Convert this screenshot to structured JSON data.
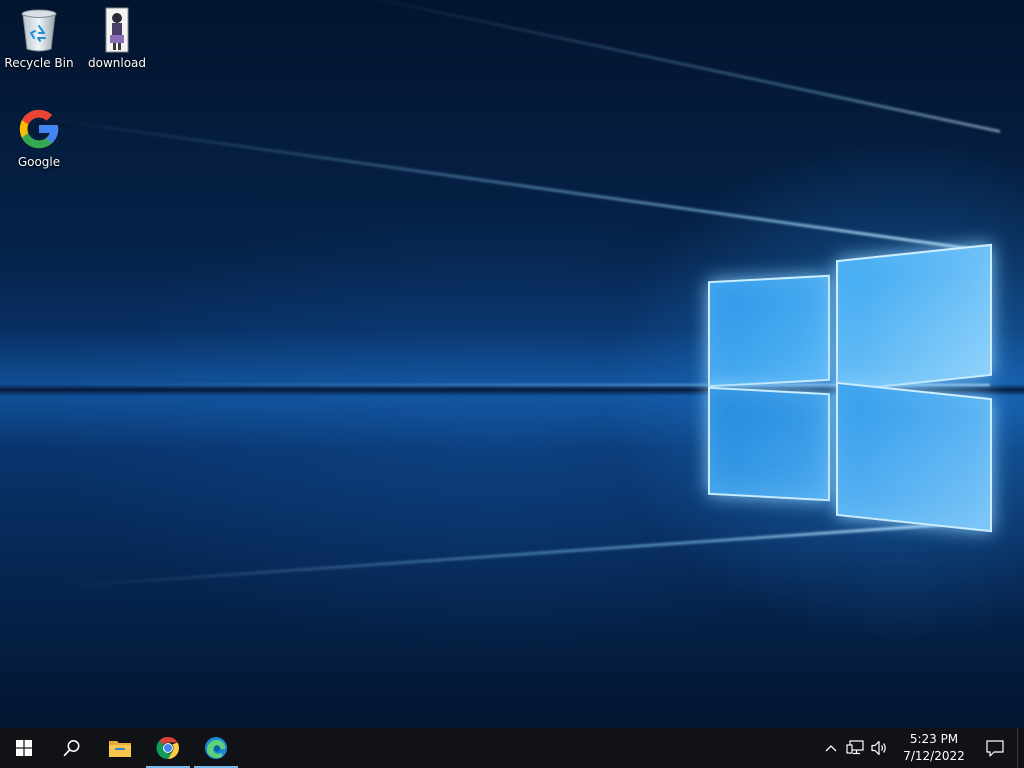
{
  "desktop": {
    "icons": [
      {
        "label": "Recycle Bin",
        "icon": "recycle-bin-icon"
      },
      {
        "label": "download",
        "icon": "image-file-icon"
      },
      {
        "label": "Google",
        "icon": "google-icon"
      }
    ]
  },
  "taskbar": {
    "buttons": [
      {
        "name": "start",
        "icon": "windows-logo-icon",
        "active": false
      },
      {
        "name": "search",
        "icon": "search-icon",
        "active": false
      },
      {
        "name": "file-explorer",
        "icon": "folder-icon",
        "active": false
      },
      {
        "name": "chrome",
        "icon": "chrome-icon",
        "active": true
      },
      {
        "name": "edge",
        "icon": "edge-icon",
        "active": true
      }
    ],
    "tray": {
      "icons": [
        "chevron-up-icon",
        "network-icon",
        "volume-icon"
      ],
      "time": "5:23 PM",
      "date": "7/12/2022",
      "action_center_icon": "notification-icon"
    }
  },
  "colors": {
    "taskbar_bg": "#101216",
    "active_indicator": "#76b9ed",
    "google_blue": "#4285F4",
    "google_red": "#EA4335",
    "google_yellow": "#FBBC05",
    "google_green": "#34A853"
  }
}
